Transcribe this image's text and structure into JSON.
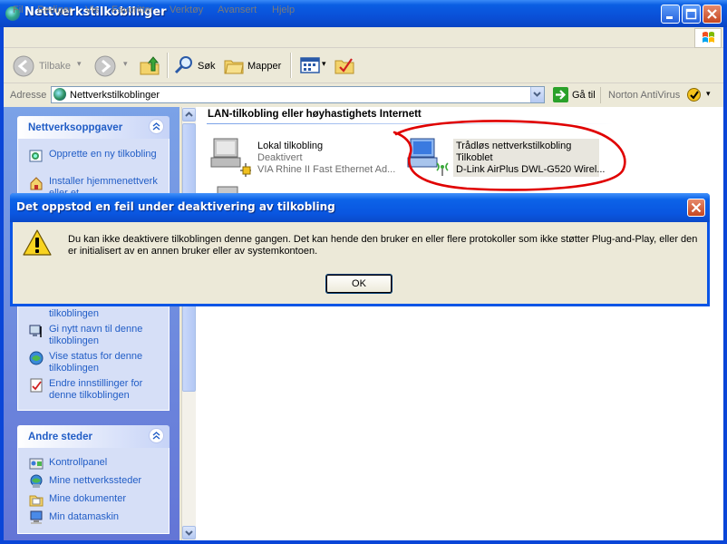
{
  "window": {
    "title": "Nettverkstilkoblinger"
  },
  "menu": [
    "Fil",
    "Rediger",
    "Vis",
    "Favoritter",
    "Verktøy",
    "Avansert",
    "Hjelp"
  ],
  "toolbar": {
    "back": "Tilbake",
    "search": "Søk",
    "folders": "Mapper"
  },
  "address": {
    "label": "Adresse",
    "value": "Nettverkstilkoblinger",
    "go": "Gå til",
    "norton": "Norton AntiVirus"
  },
  "sidebar": {
    "tasks": {
      "title": "Nettverksoppgaver",
      "items": [
        {
          "label": "Opprette en ny tilkobling",
          "icon": "new-connection-icon"
        },
        {
          "label": "Installer hjemmenettverk eller et",
          "icon": "home-network-icon"
        },
        {
          "label": "tilkoblingen",
          "icon": "disable-connection-icon"
        },
        {
          "label": "Gi nytt navn til denne tilkoblingen",
          "icon": "rename-icon"
        },
        {
          "label": "Vise status for denne tilkoblingen",
          "icon": "status-icon"
        },
        {
          "label": "Endre innstillinger for denne tilkoblingen",
          "icon": "settings-icon"
        }
      ]
    },
    "places": {
      "title": "Andre steder",
      "items": [
        {
          "label": "Kontrollpanel",
          "icon": "control-panel-icon"
        },
        {
          "label": "Mine nettverkssteder",
          "icon": "network-places-icon"
        },
        {
          "label": "Mine dokumenter",
          "icon": "documents-icon"
        },
        {
          "label": "Min datamaskin",
          "icon": "computer-icon"
        }
      ]
    }
  },
  "content": {
    "group_title": "LAN-tilkobling eller høyhastighets Internett",
    "connections": [
      {
        "name": "Lokal tilkobling",
        "status": "Deaktivert",
        "device": "VIA Rhine II Fast Ethernet Ad..."
      },
      {
        "name": "Trådløs nettverkstilkobling",
        "status": "Tilkoblet",
        "device": "D-Link AirPlus DWL-G520 Wirel..."
      }
    ],
    "annotation_color": "#e00000"
  },
  "dialog": {
    "title": "Det oppstod en feil under deaktivering av tilkobling",
    "message": "Du kan ikke deaktivere tilkoblingen denne gangen. Det kan hende den bruker en eller flere protokoller som ikke støtter Plug-and-Play, eller den er initialisert av en annen bruker eller av systemkontoen.",
    "ok": "OK",
    "icon": "warning-icon"
  },
  "colors": {
    "titlebar": "#0a50d8",
    "taskpane": "#6f8fe0",
    "link": "#215dc6",
    "dialog_face": "#ece9d8"
  }
}
